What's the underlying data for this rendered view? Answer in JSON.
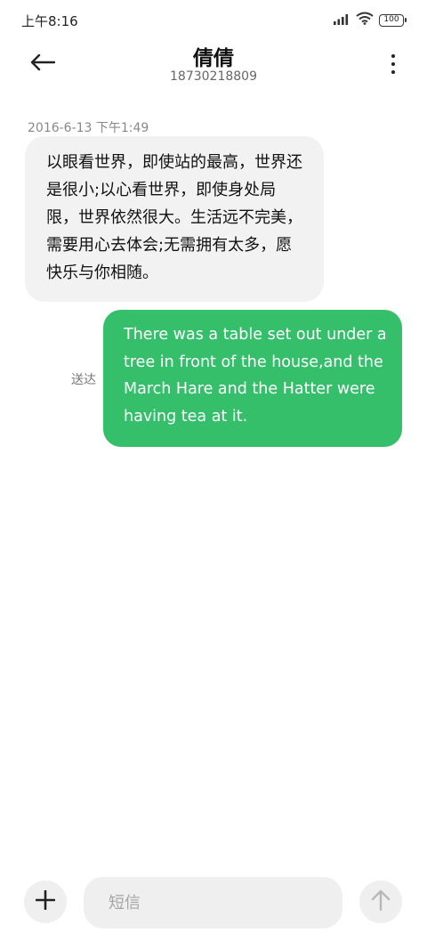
{
  "status_bar": {
    "time": "上午8:16",
    "battery": "100",
    "icons": [
      "signal-icon",
      "wifi-icon",
      "battery-icon"
    ]
  },
  "header": {
    "contact_name": "倩倩",
    "contact_number": "18730218809",
    "icons": [
      "back-arrow-icon",
      "more-vertical-icon"
    ]
  },
  "conversation": {
    "timestamp": "2016-6-13 下午1:49",
    "incoming_message": "以眼看世界，即使站的最高，世界还是很小;以心看世界，即使身处局限，世界依然很大。生活远不完美，需要用心去体会;无需拥有太多，愿快乐与你相随。",
    "outgoing_message": "There was a table set out under a tree in front of the house,and the March Hare and the Hatter were having tea at it.",
    "delivery_status": "送达"
  },
  "composer": {
    "placeholder": "短信",
    "icons": [
      "plus-icon",
      "send-arrow-icon"
    ]
  },
  "colors": {
    "outgoing_bubble": "#35bf6b",
    "incoming_bubble": "#f2f2f2",
    "composer_bg": "#efefef"
  }
}
